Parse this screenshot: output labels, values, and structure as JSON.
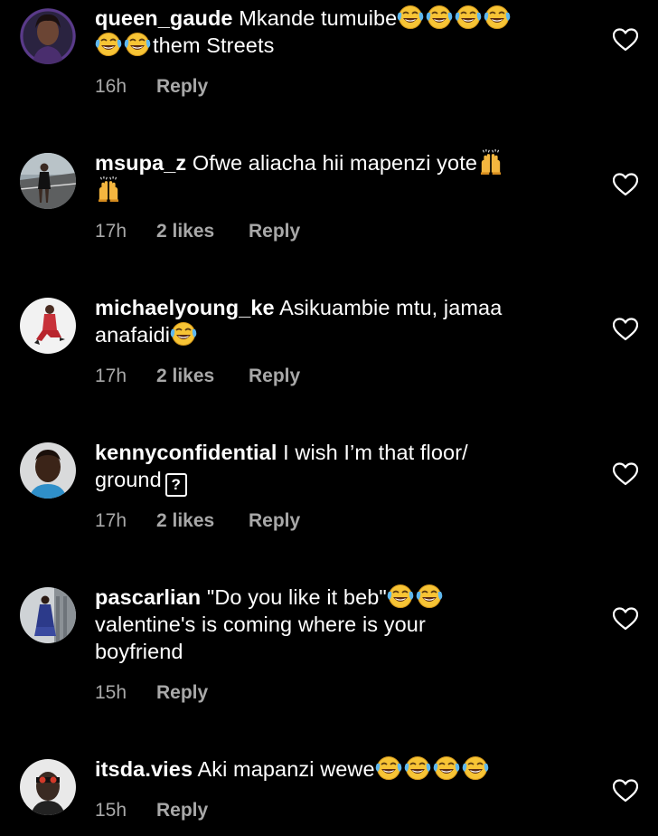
{
  "comments": [
    {
      "username": "queen_gaude",
      "text_before": "Mkande tumuibe",
      "emojis_a": 4,
      "line2_emojis": 2,
      "text_after": "them Streets",
      "time": "16h",
      "likes": "",
      "reply": "Reply"
    },
    {
      "username": "msupa_z",
      "text_before": "Ofwe aliacha hii mapenzi yote",
      "emoji_name": "raising-hands-icon",
      "time": "17h",
      "likes": "2 likes",
      "reply": "Reply"
    },
    {
      "username": "michaelyoung_ke",
      "text_before": "Asikuambie mtu, jamaa",
      "text_line2": "anafaidi",
      "time": "17h",
      "likes": "2 likes",
      "reply": "Reply"
    },
    {
      "username": "kennyconfidential",
      "text_before": "I wish I’m that floor/",
      "text_line2": "ground",
      "unknown_glyph": "?",
      "time": "17h",
      "likes": "2 likes",
      "reply": "Reply"
    },
    {
      "username": "pascarlian",
      "text_before": "\"Do you like it beb\"",
      "text_line2": "valentine's is coming where is your",
      "text_line3": "boyfriend",
      "time": "15h",
      "likes": "",
      "reply": "Reply"
    },
    {
      "username": "itsda.vies",
      "text_before": "Aki mapanzi wewe",
      "time": "15h",
      "likes": "",
      "reply": "Reply"
    }
  ],
  "colors": {
    "background": "#000000",
    "text": "#ffffff",
    "meta": "#a8a8a8",
    "emoji_yellow": "#f7c435"
  },
  "icons": {
    "like": "heart-outline-icon",
    "laugh": "face-with-tears-of-joy-icon",
    "hands": "raising-hands-icon"
  }
}
